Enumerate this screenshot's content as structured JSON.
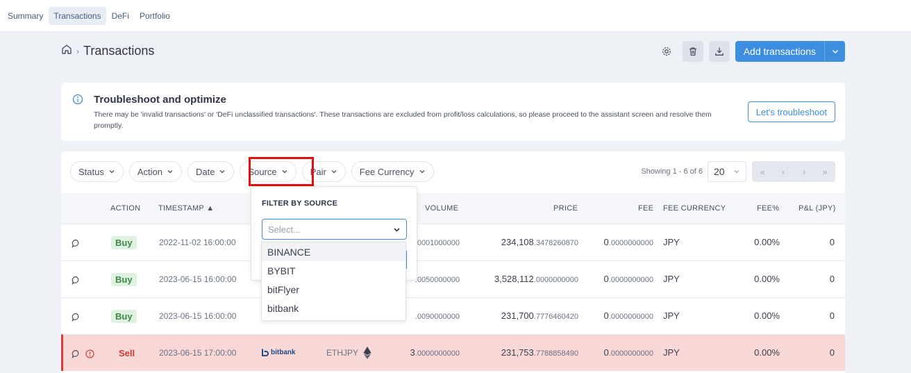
{
  "nav": {
    "tabs": [
      "Summary",
      "Transactions",
      "DeFi",
      "Portfolio"
    ]
  },
  "header": {
    "breadcrumb_sep": "›",
    "title": "Transactions",
    "add_label": "Add transactions"
  },
  "troubleshoot": {
    "title": "Troubleshoot and optimize",
    "text": "There may be 'invalid transactions' or 'DeFi unclassified transactions'. These transactions are excluded from profit/loss calculations, so please proceed to the assistant screen and resolve them promptly.",
    "button": "Let's troubleshoot"
  },
  "filters": [
    "Status",
    "Action",
    "Date",
    "Source",
    "Pair",
    "Fee Currency"
  ],
  "pagination": {
    "showing": "Showing 1 - 6 of 6",
    "per_page": "20"
  },
  "columns": {
    "action": "ACTION",
    "timestamp": "TIMESTAMP",
    "volume": "VOLUME",
    "price": "PRICE",
    "fee": "FEE",
    "fee_currency": "FEE CURRENCY",
    "fee_pct": "FEE%",
    "pnl": "P&L (JPY)"
  },
  "rows": [
    {
      "action": "Buy",
      "timestamp": "2022-11-02 16:00:00",
      "volume_int": "",
      "volume_dec": ".0001000000",
      "price_int": "234,108",
      "price_dec": ".3478260870",
      "fee_int": "0",
      "fee_dec": ".0000000000",
      "fee_currency": "JPY",
      "fee_pct": "0.00%",
      "pnl": "0"
    },
    {
      "action": "Buy",
      "timestamp": "2023-06-15 16:00:00",
      "volume_int": "",
      "volume_dec": ".0050000000",
      "price_int": "3,528,112",
      "price_dec": ".0000000000",
      "fee_int": "0",
      "fee_dec": ".0000000000",
      "fee_currency": "JPY",
      "fee_pct": "0.00%",
      "pnl": "0"
    },
    {
      "action": "Buy",
      "timestamp": "2023-06-15 16:00:00",
      "volume_int": "",
      "volume_dec": ".0090000000",
      "price_int": "231,700",
      "price_dec": ".7776460420",
      "fee_int": "0",
      "fee_dec": ".0000000000",
      "fee_currency": "JPY",
      "fee_pct": "0.00%",
      "pnl": "0"
    },
    {
      "action": "Sell",
      "timestamp": "2023-06-15 17:00:00",
      "source": "bitbank",
      "pair": "ETHJPY",
      "volume_int": "3",
      "volume_dec": ".0000000000",
      "price_int": "231,753",
      "price_dec": ".7788858490",
      "fee_int": "0",
      "fee_dec": ".0000000000",
      "fee_currency": "JPY",
      "fee_pct": "0.00%",
      "pnl": "0"
    }
  ],
  "source_filter": {
    "header": "FILTER BY SOURCE",
    "placeholder": "Select...",
    "options": [
      "BINANCE",
      "BYBIT",
      "bitFlyer",
      "bitbank"
    ]
  },
  "colors": {
    "accent": "#3d8ede",
    "highlight": "#e01010",
    "sell_row": "#f8d7d7"
  }
}
